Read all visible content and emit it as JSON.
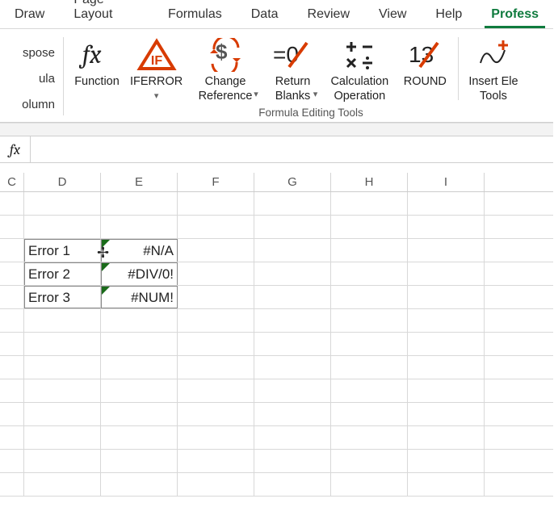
{
  "tabs": {
    "draw": "Draw",
    "page_layout": "Page Layout",
    "formulas": "Formulas",
    "data": "Data",
    "review": "Review",
    "view": "View",
    "help": "Help",
    "professor": "Profess"
  },
  "side": {
    "spose": "spose",
    "ula": "ula",
    "olumn": "olumn"
  },
  "ribbon": {
    "function": "Function",
    "iferror": "IFERROR",
    "change_reference": "Change\nReference",
    "return_blanks": "Return\nBlanks",
    "calculation_operation": "Calculation\nOperation",
    "round": "ROUND",
    "insert_tools": "Insert Ele\nTools",
    "group_title": "Formula Editing Tools"
  },
  "formula_bar": {
    "fx": "fx",
    "value": ""
  },
  "columns": [
    "C",
    "D",
    "E",
    "F",
    "G",
    "H",
    "I"
  ],
  "cells": {
    "d3": "Error 1",
    "e3": "#N/A",
    "d4": "Error 2",
    "e4": "#DIV/0!",
    "d5": "Error 3",
    "e5": "#NUM!"
  }
}
